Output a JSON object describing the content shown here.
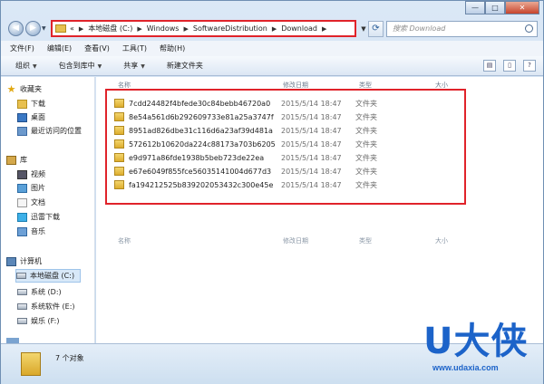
{
  "address": {
    "crumbs": [
      "本地磁盘 (C:)",
      "Windows",
      "SoftwareDistribution",
      "Download"
    ],
    "prefix": "«"
  },
  "search": {
    "placeholder": "搜索 Download"
  },
  "menu": [
    "文件(F)",
    "编辑(E)",
    "查看(V)",
    "工具(T)",
    "帮助(H)"
  ],
  "toolbar": {
    "organize": "组织",
    "include_library": "包含到库中",
    "share": "共享",
    "new_folder": "新建文件夹"
  },
  "nav": {
    "favorites": "收藏夹",
    "fav_items": [
      "下载",
      "桌面",
      "最近访问的位置"
    ],
    "libraries": "库",
    "lib_items": [
      "视频",
      "图片",
      "文档",
      "迅雷下载",
      "音乐"
    ],
    "computer": "计算机",
    "comp_items": [
      "本地磁盘 (C:)",
      "系统 (D:)",
      "系统软件 (E:)",
      "娱乐 (F:)"
    ],
    "network_partial": "网络"
  },
  "columns": {
    "name": "名称",
    "date": "修改日期",
    "type": "类型",
    "size": "大小"
  },
  "files": [
    {
      "name": "7cdd24482f4bfede30c84bebb46720a0",
      "date": "2015/5/14 18:47",
      "type": "文件夹"
    },
    {
      "name": "8e54a561d6b292609733e81a25a3747f",
      "date": "2015/5/14 18:47",
      "type": "文件夹"
    },
    {
      "name": "8951ad826dbe31c116d6a23af39d481a",
      "date": "2015/5/14 18:47",
      "type": "文件夹"
    },
    {
      "name": "572612b10620da224c88173a703b6205",
      "date": "2015/5/14 18:47",
      "type": "文件夹"
    },
    {
      "name": "e9d971a86fde1938b5beb723de22ea",
      "date": "2015/5/14 18:47",
      "type": "文件夹"
    },
    {
      "name": "e67e6049f855fce56035141004d677d3",
      "date": "2015/5/14 18:47",
      "type": "文件夹"
    },
    {
      "name": "fa194212525b839202053432c300e45e",
      "date": "2015/5/14 18:47",
      "type": "文件夹"
    }
  ],
  "status": {
    "count": "7 个对象"
  },
  "watermark": {
    "brand": "U大侠",
    "url": "www.udaxia.com"
  },
  "colors": {
    "highlight": "#e0232a",
    "brand": "#1c63c9"
  }
}
